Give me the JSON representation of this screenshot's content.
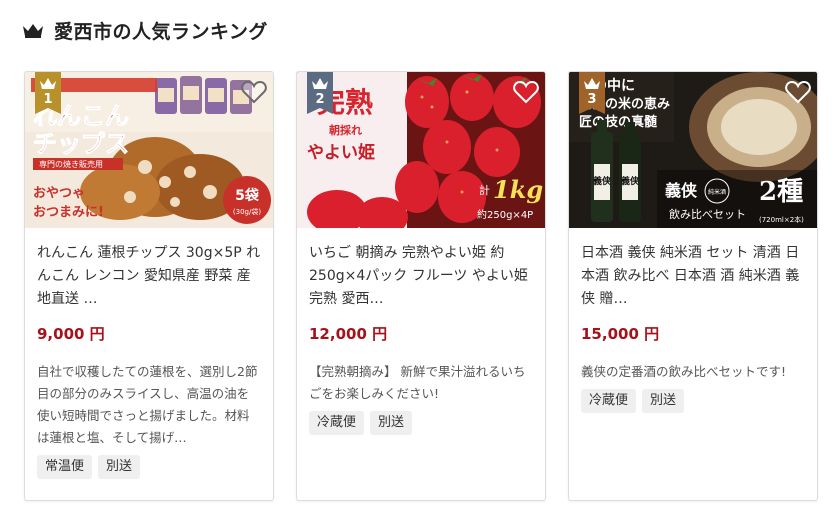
{
  "header": {
    "title": "愛西市の人気ランキング",
    "icon": "crown-icon"
  },
  "colors": {
    "price": "#a6121a",
    "gold": "#b8912a",
    "silver": "#5a6b82",
    "bronze": "#a0642a"
  },
  "cards": [
    {
      "rank": "1",
      "image_text": {
        "line1": "れんこん",
        "line2": "チップス",
        "sub": "専門の焼き販売用",
        "bag": "れんこんチップス",
        "note1": "おやつゃ",
        "note2": "おつまみに!",
        "pack": "5袋",
        "pack_sub": "(30g/袋)"
      },
      "name": "れんこん 蓮根チップス 30g×5P れんこん レンコン 愛知県産 野菜 産地直送 …",
      "price": "9,000 円",
      "description": "自社で収穫したての蓮根を、選別し2節目の部分のみスライスし、高温の油を使い短時間でさっと揚げました。材料は蓮根と塩、そして揚げ…",
      "tags": [
        "常温便",
        "別送"
      ]
    },
    {
      "rank": "2",
      "image_text": {
        "line1": "完熟",
        "line2": "朝採れ",
        "line3": "やよい姫",
        "qty_label": "計",
        "qty": "1kg",
        "qty_sub": "約250g×4P"
      },
      "name": "いちご 朝摘み 完熟やよい姫 約250g×4パック フルーツ やよい姫 完熟 愛西…",
      "price": "12,000 円",
      "description": "【完熟朝摘み】 新鮮で果汁溢れるいちごをお楽しみください!",
      "tags": [
        "冷蔵便",
        "別送"
      ]
    },
    {
      "rank": "3",
      "image_text": {
        "line1": "酒の中に",
        "line2": "尾張の米の恵み",
        "line3": "匠の技の真髄",
        "brand": "義侠",
        "seal": "純米酒",
        "title": "2種",
        "sub": "飲み比べセット",
        "spec": "(720ml×2本)"
      },
      "name": "日本酒 義侠 純米酒 セット 清酒 日本酒 飲み比べ 日本酒 酒 純米酒 義侠 贈…",
      "price": "15,000 円",
      "description": "義侠の定番酒の飲み比べセットです!",
      "tags": [
        "冷蔵便",
        "別送"
      ]
    }
  ]
}
